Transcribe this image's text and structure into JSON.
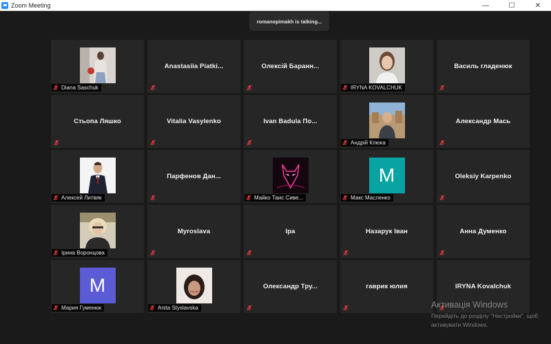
{
  "window": {
    "title": "Zoom Meeting",
    "minimize": "—",
    "maximize": "☐",
    "close": "✕"
  },
  "talking_indicator": "romanopimakh is talking...",
  "participants": [
    {
      "name": "Diana Saschuk",
      "video": "photo-woman-standing"
    },
    {
      "display": "Anastasiia  Piatki..."
    },
    {
      "display": "Олексій  Баранн..."
    },
    {
      "name": "IRYNA KOVALCHUK",
      "video": "photo-woman-portrait"
    },
    {
      "display": "Василь гладенюк"
    },
    {
      "display": "Стьопа Ляшко"
    },
    {
      "display": "Vitalia Vasylenko"
    },
    {
      "display": "Ivan  Badula  По..."
    },
    {
      "name": "Андрій Клюка",
      "video": "photo-man-outdoor"
    },
    {
      "display": "Александр Мась"
    },
    {
      "name": "Алексей Литвяк",
      "video": "photo-man-suit"
    },
    {
      "display": "Парфенов  Дан..."
    },
    {
      "name": "Майко Таис Сиве...",
      "video": "photo-neon-wolf"
    },
    {
      "name": "Макс Масленко",
      "avatar_letter": "M",
      "avatar_color": "#0aa3a3"
    },
    {
      "display": "Oleksiy Karpenko"
    },
    {
      "name": "Ірина Воронцова",
      "video": "photo-woman-blonde"
    },
    {
      "display": "Myroslava"
    },
    {
      "display": "Іра"
    },
    {
      "display": "Назарук Іван"
    },
    {
      "display": "Анна Думенко"
    },
    {
      "name": "Мария Гуменюк",
      "avatar_letter": "M",
      "avatar_color": "#5b5bd6"
    },
    {
      "name": "Anita Styslavska",
      "video": "photo-woman-dark"
    },
    {
      "display": "Олександр  Тру..."
    },
    {
      "display": "гаврик юлия"
    },
    {
      "display": "IRYNA Kovalchuk"
    }
  ],
  "activation": {
    "title": "Активація Windows",
    "line1": "Перейдіть до розділу \"Настройки\", щоб",
    "line2": "активувати Windows."
  },
  "colors": {
    "muted_mic": "#e03a3a",
    "tile_bg": "#262626",
    "app_bg": "#1a1a1a"
  }
}
